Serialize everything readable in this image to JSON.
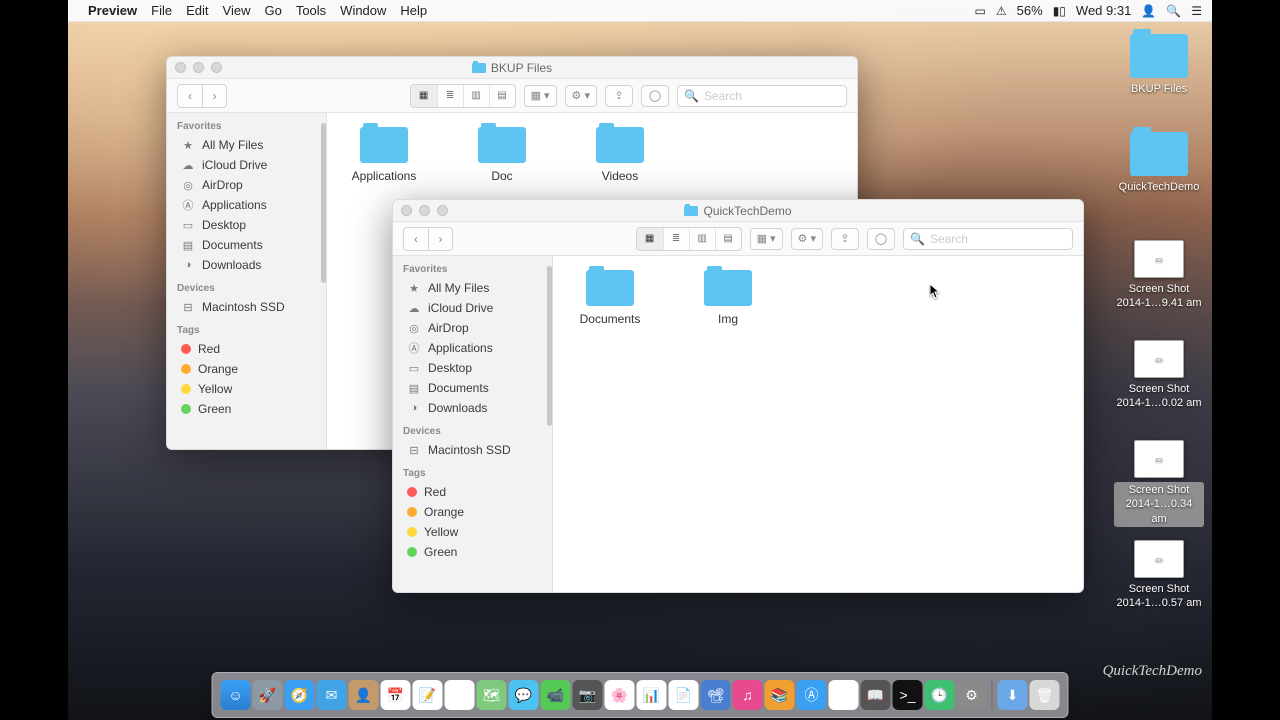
{
  "menubar": {
    "app": "Preview",
    "items": [
      "File",
      "Edit",
      "View",
      "Go",
      "Tools",
      "Window",
      "Help"
    ],
    "right": {
      "battery": "56%",
      "clock": "Wed 9:31"
    }
  },
  "desktop": [
    {
      "type": "folder",
      "label": "BKUP Files"
    },
    {
      "type": "folder",
      "label": "QuickTechDemo"
    },
    {
      "type": "file",
      "label": "Screen Shot 2014-1…9.41 am"
    },
    {
      "type": "file",
      "label": "Screen Shot 2014-1…0.02 am"
    },
    {
      "type": "file",
      "label": "Screen Shot 2014-1…0.34 am",
      "selected": true
    },
    {
      "type": "file",
      "label": "Screen Shot 2014-1…0.57 am"
    }
  ],
  "sidebar": {
    "favorites_label": "Favorites",
    "favorites": [
      {
        "icon": "star",
        "label": "All My Files"
      },
      {
        "icon": "cloud",
        "label": "iCloud Drive"
      },
      {
        "icon": "airdrop",
        "label": "AirDrop"
      },
      {
        "icon": "apps",
        "label": "Applications"
      },
      {
        "icon": "desktop",
        "label": "Desktop"
      },
      {
        "icon": "docs",
        "label": "Documents"
      },
      {
        "icon": "downloads",
        "label": "Downloads"
      }
    ],
    "devices_label": "Devices",
    "devices": [
      {
        "icon": "disk",
        "label": "Macintosh SSD"
      }
    ],
    "tags_label": "Tags",
    "tags": [
      {
        "color": "#ff5b56",
        "label": "Red"
      },
      {
        "color": "#ffaa33",
        "label": "Orange"
      },
      {
        "color": "#ffd93b",
        "label": "Yellow"
      },
      {
        "color": "#63d35f",
        "label": "Green"
      }
    ]
  },
  "window1": {
    "title": "BKUP Files",
    "search_placeholder": "Search",
    "items": [
      {
        "label": "Applications"
      },
      {
        "label": "Doc"
      },
      {
        "label": "Videos"
      }
    ]
  },
  "window2": {
    "title": "QuickTechDemo",
    "search_placeholder": "Search",
    "items": [
      {
        "label": "Documents"
      },
      {
        "label": "Img"
      }
    ]
  },
  "dock": {
    "apps": [
      {
        "name": "finder",
        "bg": "linear-gradient(#3aa0f4,#2a7fd0)",
        "glyph": "☺"
      },
      {
        "name": "launchpad",
        "bg": "#8d9aa5",
        "glyph": "🚀"
      },
      {
        "name": "safari",
        "bg": "#3aa0f4",
        "glyph": "🧭"
      },
      {
        "name": "mail",
        "bg": "#3fa3e6",
        "glyph": "✉"
      },
      {
        "name": "contacts",
        "bg": "#c59a6a",
        "glyph": "👤"
      },
      {
        "name": "calendar",
        "bg": "#fff",
        "glyph": "📅"
      },
      {
        "name": "notes",
        "bg": "#fff",
        "glyph": "📝"
      },
      {
        "name": "reminders",
        "bg": "#fff",
        "glyph": "☑"
      },
      {
        "name": "maps",
        "bg": "#7fc97f",
        "glyph": "🗺"
      },
      {
        "name": "messages",
        "bg": "#4cc2f0",
        "glyph": "💬"
      },
      {
        "name": "facetime",
        "bg": "#55c955",
        "glyph": "📹"
      },
      {
        "name": "photobooth",
        "bg": "#555",
        "glyph": "📷"
      },
      {
        "name": "photos",
        "bg": "#fff",
        "glyph": "🌸"
      },
      {
        "name": "numbers",
        "bg": "#fff",
        "glyph": "📊"
      },
      {
        "name": "pages",
        "bg": "#fff",
        "glyph": "📄"
      },
      {
        "name": "keynote",
        "bg": "#4a7fd0",
        "glyph": "📽"
      },
      {
        "name": "itunes",
        "bg": "#e84a8f",
        "glyph": "♫"
      },
      {
        "name": "ibooks",
        "bg": "#f0a030",
        "glyph": "📚"
      },
      {
        "name": "appstore",
        "bg": "#3aa0f4",
        "glyph": "Ⓐ"
      },
      {
        "name": "preview",
        "bg": "#fff",
        "glyph": "👁"
      },
      {
        "name": "dictionary",
        "bg": "#555",
        "glyph": "📖"
      },
      {
        "name": "terminal",
        "bg": "#111",
        "glyph": ">_"
      },
      {
        "name": "timemachine",
        "bg": "#3fc070",
        "glyph": "🕒"
      },
      {
        "name": "sysprefs",
        "bg": "#8a8a8a",
        "glyph": "⚙"
      }
    ],
    "right": [
      {
        "name": "downloads",
        "bg": "#6aa8e8",
        "glyph": "⬇"
      },
      {
        "name": "trash",
        "bg": "#d8d8d8",
        "glyph": "🗑"
      }
    ]
  },
  "watermark": "QuickTechDemo"
}
